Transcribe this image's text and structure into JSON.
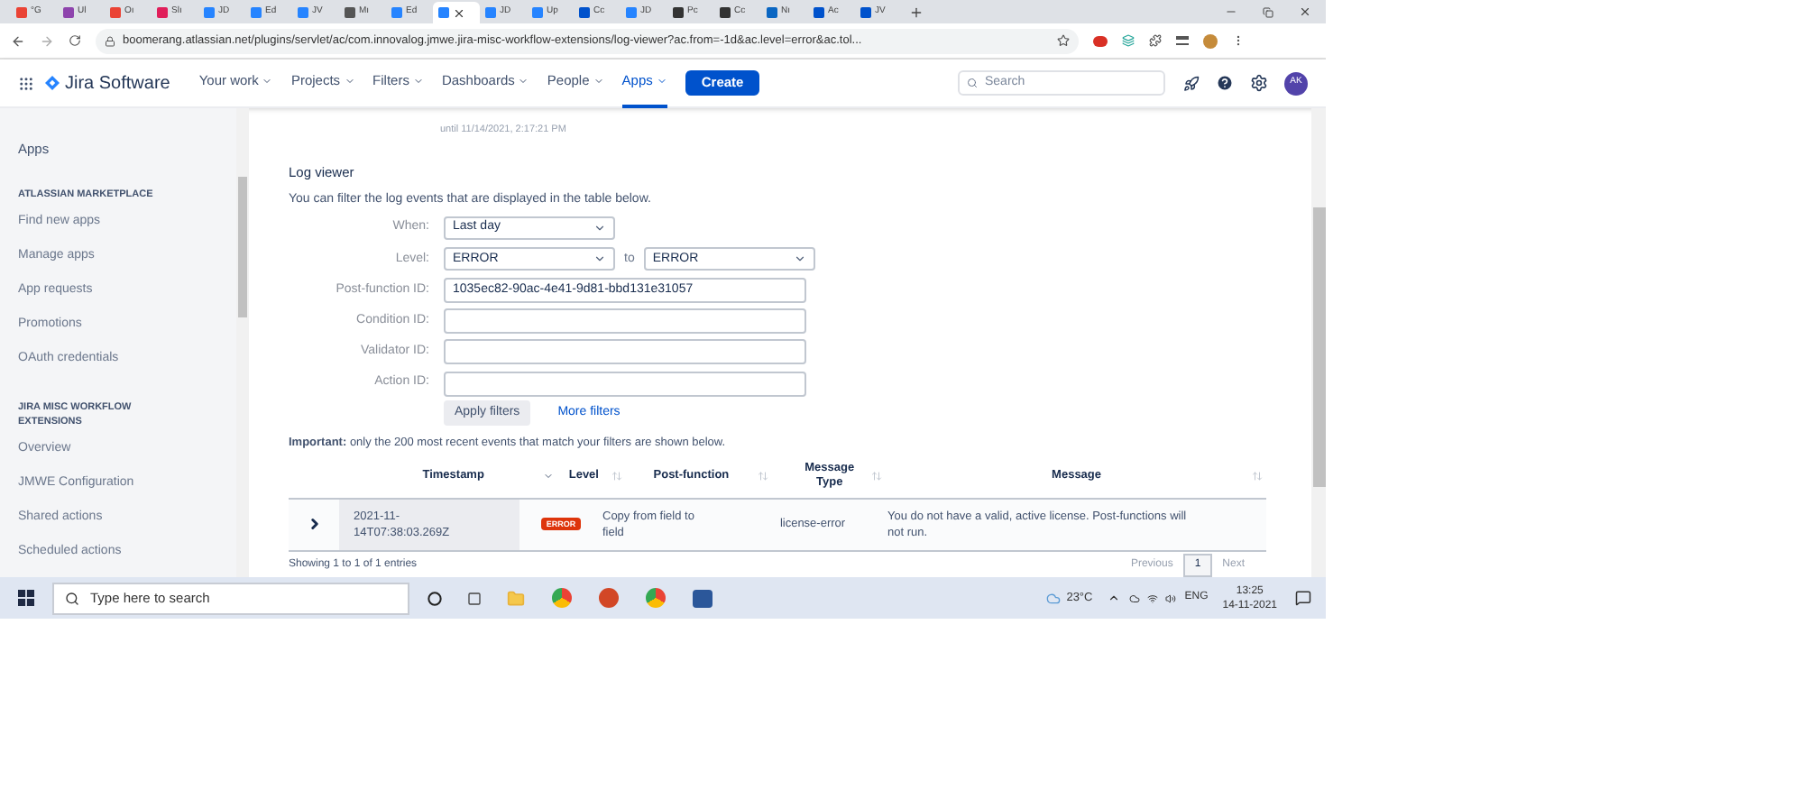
{
  "browser": {
    "tabs": [
      {
        "label": "°G",
        "color": "#ea4335",
        "selected": false
      },
      {
        "label": "Ul",
        "color": "#8e44ad",
        "selected": false
      },
      {
        "label": "Oı",
        "color": "#ea4335",
        "selected": false
      },
      {
        "label": "Slı",
        "color": "#e01e5a",
        "selected": false
      },
      {
        "label": "JD",
        "color": "#2684ff",
        "selected": false
      },
      {
        "label": "Ed",
        "color": "#2684ff",
        "selected": false
      },
      {
        "label": "JV",
        "color": "#2684ff",
        "selected": false
      },
      {
        "label": "Mı",
        "color": "#555555",
        "selected": false
      },
      {
        "label": "Ed",
        "color": "#2684ff",
        "selected": false
      },
      {
        "color": "#2684ff",
        "selected": true
      },
      {
        "label": "JD",
        "color": "#2684ff",
        "selected": false
      },
      {
        "label": "Up",
        "color": "#2684ff",
        "selected": false
      },
      {
        "label": "Cc",
        "color": "#0052cc",
        "selected": false
      },
      {
        "label": "JD",
        "color": "#2684ff",
        "selected": false
      },
      {
        "label": "Pc",
        "color": "#333333",
        "selected": false
      },
      {
        "label": "Cc",
        "color": "#333333",
        "selected": false
      },
      {
        "label": "Nı",
        "color": "#0a66c2",
        "selected": false
      },
      {
        "label": "Ac",
        "color": "#0052cc",
        "selected": false
      },
      {
        "label": "JV",
        "color": "#0052cc",
        "selected": false
      }
    ],
    "url": "boomerang.atlassian.net/plugins/servlet/ac/com.innovalog.jmwe.jira-misc-workflow-extensions/log-viewer?ac.from=-1d&ac.level=error&ac.tol..."
  },
  "header": {
    "product": "Jira Software",
    "nav": [
      {
        "label": "Your work",
        "selected": false
      },
      {
        "label": "Projects",
        "selected": false
      },
      {
        "label": "Filters",
        "selected": false
      },
      {
        "label": "Dashboards",
        "selected": false
      },
      {
        "label": "People",
        "selected": false
      },
      {
        "label": "Apps",
        "selected": true
      }
    ],
    "create": "Create",
    "search_placeholder": "Search",
    "avatar": "AK"
  },
  "sidebar": {
    "title": "Apps",
    "sections": [
      {
        "heading": "ATLASSIAN MARKETPLACE",
        "items": [
          "Find new apps",
          "Manage apps",
          "App requests",
          "Promotions",
          "OAuth credentials"
        ]
      },
      {
        "heading": "JIRA MISC WORKFLOW EXTENSIONS",
        "items": [
          "Overview",
          "JMWE Configuration",
          "Shared actions",
          "Scheduled actions"
        ]
      }
    ]
  },
  "log_viewer": {
    "until_note": "until 11/14/2021, 2:17:21 PM",
    "title": "Log viewer",
    "description": "You can filter the log events that are displayed in the table below.",
    "filters": [
      {
        "kind": "select",
        "label": "When:",
        "value": "Last day"
      },
      {
        "kind": "range",
        "label": "Level:",
        "value": "ERROR",
        "connector": "to",
        "value_to": "ERROR"
      },
      {
        "kind": "text",
        "label": "Post-function ID:",
        "value": "1035ec82-90ac-4e41-9d81-bbd131e31057"
      },
      {
        "kind": "text",
        "label": "Condition ID:"
      },
      {
        "kind": "text",
        "label": "Validator ID:"
      },
      {
        "kind": "text",
        "label": "Action ID:"
      }
    ],
    "apply_button": "Apply filters",
    "more_filters": "More filters",
    "notice": "**Important:** only the 200 most recent events that match your filters are shown below."
  },
  "table": {
    "columns": [
      {
        "label": "Timestamp",
        "sorted": true
      },
      {
        "label": "Level",
        "sorted": false
      },
      {
        "label": "Post-function",
        "sorted": false
      },
      {
        "label": "Message Type",
        "sorted": false
      },
      {
        "label": "Message",
        "sorted": false
      }
    ],
    "rows": [
      {
        "timestamp": "2021-11-14T07:38:03.269Z",
        "level": "ERROR",
        "post_function": "Copy from field to field",
        "message_type": "license-error",
        "message": "You do not have a valid, active license. Post-functions will not run."
      }
    ],
    "footer": "Showing 1 to 1 of 1 entries",
    "pagination": {
      "previous": "Previous",
      "pages": [
        {
          "label": "1",
          "selected": true
        }
      ],
      "next": "Next"
    }
  },
  "taskbar": {
    "search_placeholder": "Type here to search",
    "weather": "23°C",
    "language": "ENG",
    "time": "13:25",
    "date": "14-11-2021"
  }
}
